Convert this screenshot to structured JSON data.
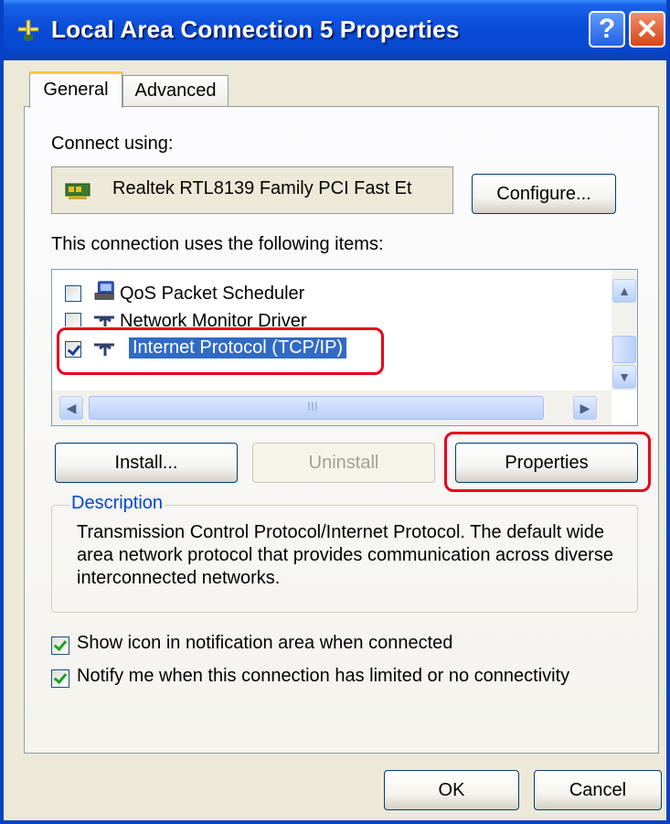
{
  "window": {
    "title": "Local Area Connection 5 Properties",
    "help_button": "?",
    "close_button": "✕"
  },
  "tabs": [
    {
      "label": "General",
      "selected": true
    },
    {
      "label": "Advanced",
      "selected": false
    }
  ],
  "connect_using": {
    "label": "Connect using:",
    "adapter": "Realtek RTL8139 Family PCI Fast Et",
    "configure_button": "Configure..."
  },
  "items_section": {
    "label": "This connection uses the following items:",
    "items": [
      {
        "label": "QoS Packet Scheduler",
        "checked": false,
        "selected": false,
        "icon": "network-service-icon"
      },
      {
        "label": "Network Monitor Driver",
        "checked": false,
        "selected": false,
        "icon": "protocol-icon"
      },
      {
        "label": "Internet Protocol (TCP/IP)",
        "checked": true,
        "selected": true,
        "icon": "protocol-icon"
      }
    ],
    "scrollbar_thumb_grip": "III"
  },
  "buttons": {
    "install": "Install...",
    "uninstall": "Uninstall",
    "properties": "Properties",
    "ok": "OK",
    "cancel": "Cancel"
  },
  "description": {
    "legend": "Description",
    "text": "Transmission Control Protocol/Internet Protocol. The default wide area network protocol that provides communication across diverse interconnected networks."
  },
  "options": [
    {
      "label": "Show icon in notification area when connected",
      "checked": true
    },
    {
      "label": "Notify me when this connection has limited or no connectivity",
      "checked": true
    }
  ],
  "colors": {
    "titlebar": "#0A4CD8",
    "dialog_bg": "#ECE9D8",
    "selection": "#316AC5",
    "highlight_annotation": "#E8001C",
    "legend_text": "#0046D5"
  }
}
